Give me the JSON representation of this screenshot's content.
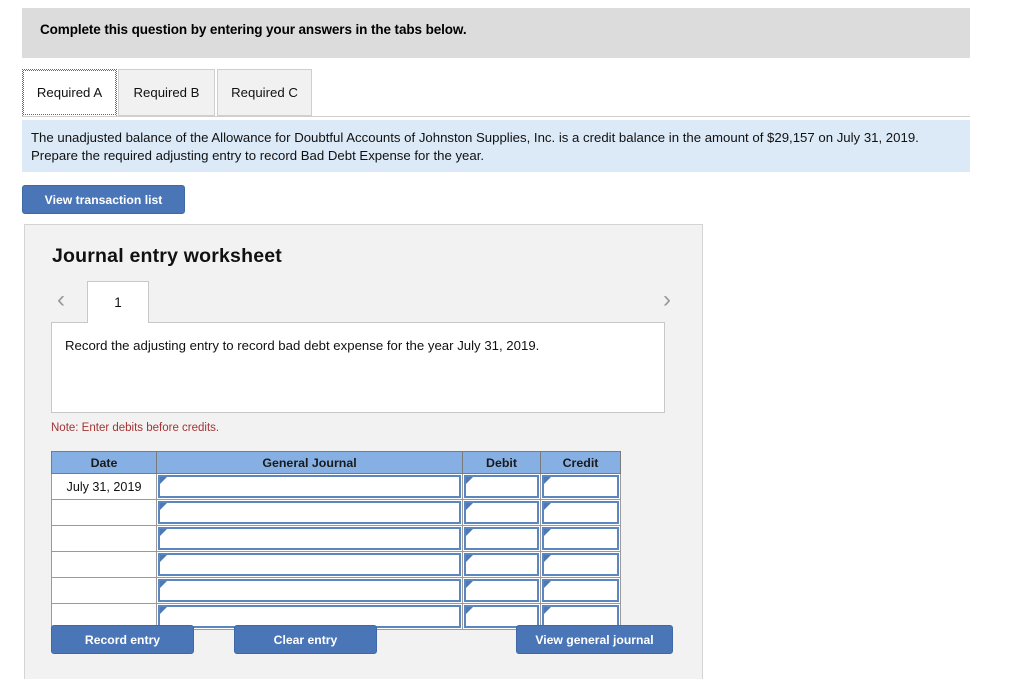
{
  "banner": {
    "text": "Complete this question by entering your answers in the tabs below."
  },
  "tabs": [
    {
      "label": "Required A",
      "active": true
    },
    {
      "label": "Required B",
      "active": false
    },
    {
      "label": "Required C",
      "active": false
    }
  ],
  "question": {
    "text": "The unadjusted balance of the Allowance for Doubtful Accounts of Johnston Supplies, Inc. is a credit balance in the amount of $29,157 on July 31, 2019. Prepare the required adjusting entry to record Bad Debt Expense for the year."
  },
  "toolbar": {
    "view_transaction_list_label": "View transaction list"
  },
  "worksheet": {
    "title": "Journal entry worksheet",
    "pager": {
      "prev_icon": "chevron-left-icon",
      "next_icon": "chevron-right-icon",
      "current_page": "1"
    },
    "description": "Record the adjusting entry to record bad debt expense for the year July 31, 2019.",
    "note": "Note: Enter debits before credits.",
    "table": {
      "headers": [
        "Date",
        "General Journal",
        "Debit",
        "Credit"
      ],
      "rows": [
        {
          "date": "July 31, 2019",
          "general_journal": "",
          "debit": "",
          "credit": ""
        },
        {
          "date": "",
          "general_journal": "",
          "debit": "",
          "credit": ""
        },
        {
          "date": "",
          "general_journal": "",
          "debit": "",
          "credit": ""
        },
        {
          "date": "",
          "general_journal": "",
          "debit": "",
          "credit": ""
        },
        {
          "date": "",
          "general_journal": "",
          "debit": "",
          "credit": ""
        },
        {
          "date": "",
          "general_journal": "",
          "debit": "",
          "credit": ""
        }
      ]
    },
    "buttons": {
      "record_entry_label": "Record entry",
      "clear_entry_label": "Clear entry",
      "view_general_journal_label": "View general journal"
    }
  },
  "colors": {
    "banner_gray": "#dcdcdc",
    "question_blue": "#dce9f7",
    "button_blue": "#4a76b8",
    "table_header_blue": "#86b0e3",
    "input_border_blue": "#5b86bf",
    "note_red": "#a33535",
    "panel_gray": "#f2f2f2"
  }
}
